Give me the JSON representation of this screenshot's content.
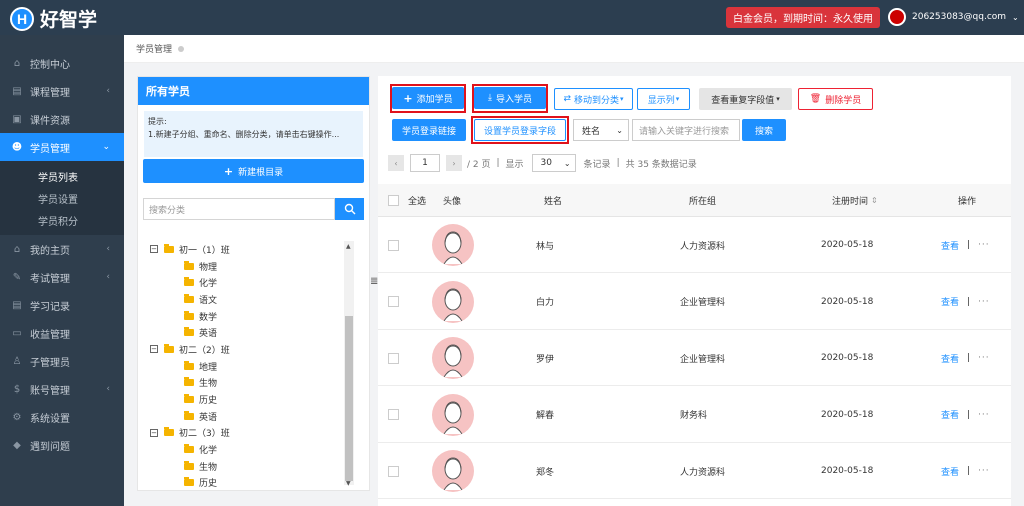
{
  "app": {
    "logo_letter": "H",
    "logo_text": "好智学"
  },
  "header": {
    "vip_text": "白金会员，到期时间：永久使用",
    "user_email": "206253083@qq.com",
    "user_chevron": "⌄"
  },
  "sidebar": {
    "items": [
      {
        "label": "控制中心",
        "icon": "⌂"
      },
      {
        "label": "课程管理",
        "icon": "▤",
        "arrow": "‹"
      },
      {
        "label": "课件资源",
        "icon": "▣"
      },
      {
        "label": "学员管理",
        "icon": "☻",
        "arrow": "⌄"
      },
      {
        "label": "我的主页",
        "icon": "⌂",
        "arrow": "‹"
      },
      {
        "label": "考试管理",
        "icon": "✎",
        "arrow": "‹"
      },
      {
        "label": "学习记录",
        "icon": "▤"
      },
      {
        "label": "收益管理",
        "icon": "▭"
      },
      {
        "label": "子管理员",
        "icon": "♙"
      },
      {
        "label": "账号管理",
        "icon": "$",
        "arrow": "‹"
      },
      {
        "label": "系统设置",
        "icon": "⚙"
      },
      {
        "label": "遇到问题",
        "icon": "◆"
      }
    ],
    "sub_items": [
      "学员列表",
      "学员设置",
      "学员积分"
    ]
  },
  "breadcrumb": {
    "label": "学员管理"
  },
  "left_panel": {
    "title": "所有学员",
    "tip_line1": "提示:",
    "tip_line2": "1.新建子分组、重命名、删除分类，请单击右键操作...",
    "new_root": "新建根目录",
    "search_placeholder": "搜索分类",
    "tree": [
      {
        "type": "group",
        "label": "初一（1）班"
      },
      {
        "type": "child",
        "label": "物理"
      },
      {
        "type": "child",
        "label": "化学"
      },
      {
        "type": "child",
        "label": "语文"
      },
      {
        "type": "child",
        "label": "数学"
      },
      {
        "type": "child",
        "label": "英语"
      },
      {
        "type": "group",
        "label": "初二（2）班"
      },
      {
        "type": "child",
        "label": "地理"
      },
      {
        "type": "child",
        "label": "生物"
      },
      {
        "type": "child",
        "label": "历史"
      },
      {
        "type": "child",
        "label": "英语"
      },
      {
        "type": "group",
        "label": "初二（3）班"
      },
      {
        "type": "child",
        "label": "化学"
      },
      {
        "type": "child",
        "label": "生物"
      },
      {
        "type": "child",
        "label": "历史"
      }
    ]
  },
  "toolbar": {
    "add": "添加学员",
    "import": "导入学员",
    "move": "移动到分类",
    "columns": "显示列",
    "dup": "查看重复字段值",
    "delete": "删除学员",
    "login_link": "学员登录链接",
    "login_field": "设置学员登录字段",
    "field_select": "姓名",
    "keyword_placeholder": "请输入关键字进行搜索",
    "search": "搜索"
  },
  "pager": {
    "page": "1",
    "total_pages": "/ 2 页",
    "show": "显示",
    "page_size": "30",
    "records": "条记录",
    "total": "共 35 条数据记录"
  },
  "table": {
    "headers": {
      "select_all": "全选",
      "avatar": "头像",
      "name": "姓名",
      "group": "所在组",
      "reg_time": "注册时间",
      "sort": "⇕",
      "action": "操作"
    },
    "rows": [
      {
        "name": "林与",
        "group": "人力资源科",
        "date": "2020-05-18"
      },
      {
        "name": "白力",
        "group": "企业管理科",
        "date": "2020-05-18"
      },
      {
        "name": "罗伊",
        "group": "企业管理科",
        "date": "2020-05-18"
      },
      {
        "name": "解春",
        "group": "财务科",
        "date": "2020-05-18"
      },
      {
        "name": "郑冬",
        "group": "人力资源科",
        "date": "2020-05-18"
      }
    ],
    "view_label": "查看",
    "sep": "|",
    "more": "···"
  }
}
